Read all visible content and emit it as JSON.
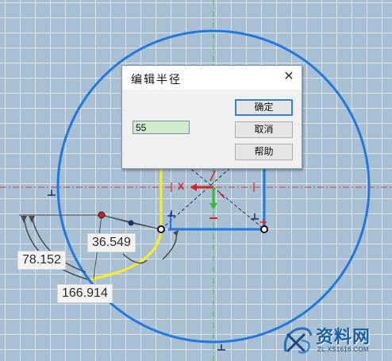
{
  "dialog": {
    "title": "编辑半径",
    "close_glyph": "✕",
    "input_value": "55",
    "buttons": {
      "ok": "确定",
      "cancel": "取消",
      "help": "帮助"
    }
  },
  "dimensions": {
    "angle_1": "36.549",
    "angle_2": "78.152",
    "angle_3": "166.914"
  },
  "sketch_marks": {
    "axis_label": "X",
    "constraint_symbol": "⊥"
  },
  "watermark": {
    "title": "资料网",
    "url": "ZL.XS1616.COM"
  },
  "colors": {
    "canvas_bg": "#a9bfd2",
    "circle": "#1e78e6",
    "selected_arc": "#ffef1a",
    "centerline": "#e03030",
    "green_axis": "#3cc23c"
  },
  "icons": {
    "close": "close-icon",
    "logo": "xs-logo-icon"
  }
}
